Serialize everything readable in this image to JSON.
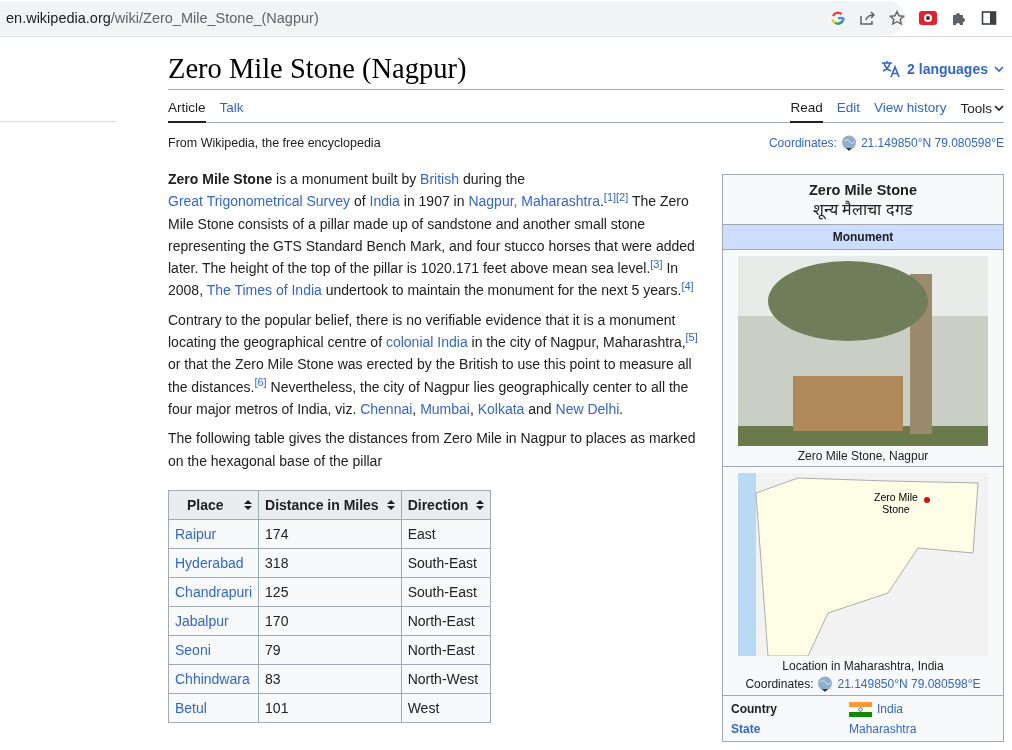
{
  "browser": {
    "url_host": "en.wikipedia.org",
    "url_path": "/wiki/Zero_Mile_Stone_(Nagpur)"
  },
  "article": {
    "title": "Zero Mile Stone (Nagpur)",
    "languages": "2 languages",
    "tabs_left": [
      {
        "label": "Article",
        "selected": true
      },
      {
        "label": "Talk",
        "selected": false
      }
    ],
    "tabs_right": [
      {
        "label": "Read",
        "selected": true,
        "kind": "tab"
      },
      {
        "label": "Edit",
        "selected": false,
        "kind": "tab"
      },
      {
        "label": "View history",
        "selected": false,
        "kind": "tab"
      },
      {
        "label": "Tools",
        "selected": false,
        "kind": "menu"
      }
    ],
    "tagline": "From Wikipedia, the free encyclopedia",
    "coordinates": {
      "label": "Coordinates:",
      "value": "21.149850°N 79.080598°E"
    },
    "paragraphs": [
      [
        {
          "kind": "bold",
          "t": "Zero Mile Stone"
        },
        {
          "kind": "text",
          "t": " is a monument built by "
        },
        {
          "kind": "link",
          "t": "British"
        },
        {
          "kind": "text",
          "t": " during the "
        },
        {
          "kind": "link",
          "t": "Great Trigonometrical Survey"
        },
        {
          "kind": "text",
          "t": " of "
        },
        {
          "kind": "link",
          "t": "India"
        },
        {
          "kind": "text",
          "t": " in 1907 in "
        },
        {
          "kind": "link",
          "t": "Nagpur, Maharashtra"
        },
        {
          "kind": "text",
          "t": "."
        },
        {
          "kind": "ref",
          "t": "[1]"
        },
        {
          "kind": "ref",
          "t": "[2]"
        },
        {
          "kind": "text",
          "t": " The Zero Mile Stone consists of a pillar made up of sandstone and another small stone representing the GTS Standard Bench Mark, and four stucco horses that were added later. The height of the top of the pillar is 1020.171 feet above mean sea level."
        },
        {
          "kind": "ref",
          "t": "[3]"
        },
        {
          "kind": "text",
          "t": " In 2008, "
        },
        {
          "kind": "link",
          "t": "The Times of India"
        },
        {
          "kind": "text",
          "t": " undertook to maintain the monument for the next 5 years."
        },
        {
          "kind": "ref",
          "t": "[4]"
        }
      ],
      [
        {
          "kind": "text",
          "t": "Contrary to the popular belief, there is no verifiable evidence that it is a monument locating the geographical centre of "
        },
        {
          "kind": "link",
          "t": "colonial India"
        },
        {
          "kind": "text",
          "t": " in the city of Nagpur, Maharashtra,"
        },
        {
          "kind": "ref",
          "t": "[5]"
        },
        {
          "kind": "text",
          "t": " or that the Zero Mile Stone was erected by the British to use this point to measure all the distances."
        },
        {
          "kind": "ref",
          "t": "[6]"
        },
        {
          "kind": "text",
          "t": " Nevertheless, the city of Nagpur lies geographically center to all the four major metros of India, viz. "
        },
        {
          "kind": "link",
          "t": "Chennai"
        },
        {
          "kind": "text",
          "t": ", "
        },
        {
          "kind": "link",
          "t": "Mumbai"
        },
        {
          "kind": "text",
          "t": ", "
        },
        {
          "kind": "link",
          "t": "Kolkata"
        },
        {
          "kind": "text",
          "t": " and "
        },
        {
          "kind": "link",
          "t": "New Delhi"
        },
        {
          "kind": "text",
          "t": "."
        }
      ],
      [
        {
          "kind": "text",
          "t": "The following table gives the distances from Zero Mile in Nagpur to places as marked on the hexagonal base of the pillar"
        }
      ]
    ],
    "table": {
      "columns": [
        "Place",
        "Distance in Miles",
        "Direction"
      ],
      "rows": [
        [
          "Raipur",
          "174",
          "East"
        ],
        [
          "Hyderabad",
          "318",
          "South-East"
        ],
        [
          "Chandrapuri",
          "125",
          "South-East"
        ],
        [
          "Jabalpur",
          "170",
          "North-East"
        ],
        [
          "Seoni",
          "79",
          "North-East"
        ],
        [
          "Chhindwara",
          "83",
          "North-West"
        ],
        [
          "Betul",
          "101",
          "West"
        ]
      ]
    }
  },
  "infobox": {
    "title": "Zero Mile Stone",
    "native_title": "शून्य मैलाचा दगड",
    "type": "Monument",
    "photo_caption": "Zero Mile Stone, Nagpur",
    "map_label": "Zero Mile Stone",
    "map_caption": "Location in Maharashtra, India",
    "coordinates": {
      "label": "Coordinates:",
      "value": "21.149850°N 79.080598°E"
    },
    "rows": [
      {
        "label": "Country",
        "label_link": false,
        "value": "India",
        "flag": true
      },
      {
        "label": "State",
        "label_link": true,
        "value": "Maharashtra"
      }
    ]
  }
}
